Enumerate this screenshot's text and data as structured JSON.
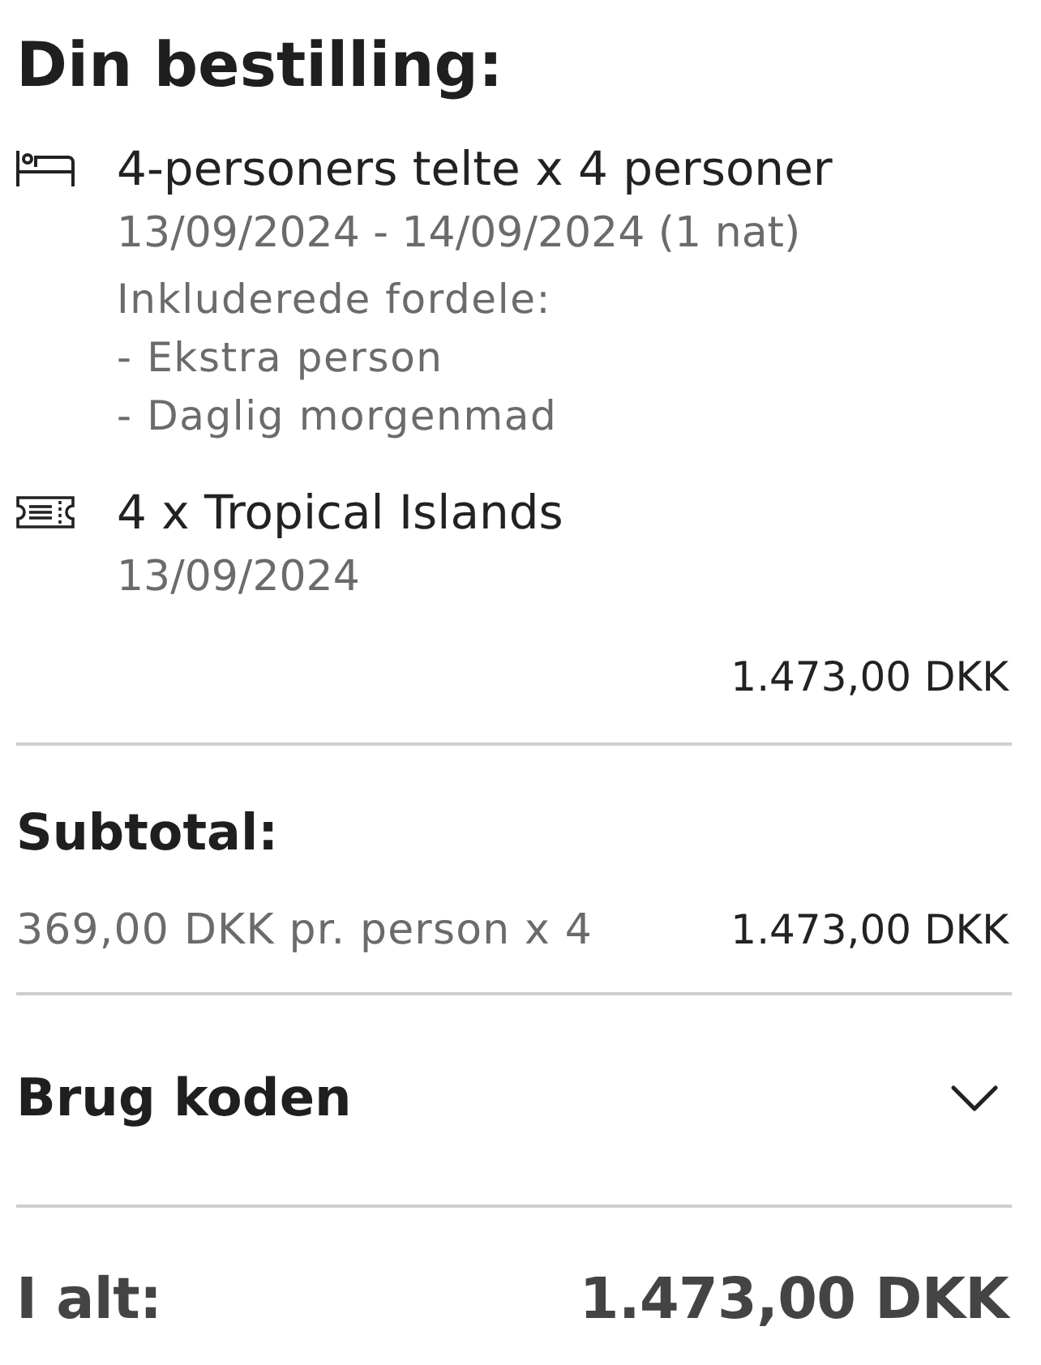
{
  "title": "Din bestilling:",
  "items": [
    {
      "kind": "accommodation",
      "name": "4-personers telte x 4 personer",
      "dates": "13/09/2024 - 14/09/2024 (1 nat)",
      "benefits_label": "Inkluderede fordele:",
      "benefits": [
        "- Ekstra person",
        "- Daglig morgenmad"
      ]
    },
    {
      "kind": "ticket",
      "name": "4 x Tropical Islands",
      "dates": "13/09/2024"
    }
  ],
  "items_total": "1.473,00 DKK",
  "subtotal": {
    "label": "Subtotal:",
    "description": "369,00 DKK pr. person x 4",
    "amount": "1.473,00 DKK"
  },
  "discount_code": {
    "label": "Brug koden",
    "expanded": false
  },
  "total": {
    "label": "I alt:",
    "amount": "1.473,00 DKK"
  }
}
